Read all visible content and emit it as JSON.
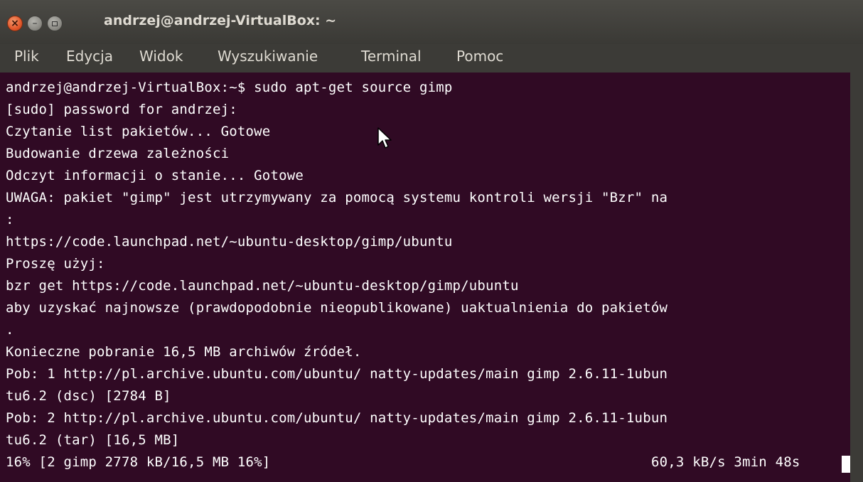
{
  "window": {
    "title": "andrzej@andrzej-VirtualBox: ~",
    "close_glyph": "×",
    "minimize_glyph": "–"
  },
  "menu": [
    "Plik",
    "Edycja",
    "Widok",
    "Wyszukiwanie",
    "Terminal",
    "Pomoc"
  ],
  "terminal": {
    "lines": [
      "andrzej@andrzej-VirtualBox:~$ sudo apt-get source gimp",
      "[sudo] password for andrzej:",
      "Czytanie list pakietów... Gotowe",
      "Budowanie drzewa zależności",
      "Odczyt informacji o stanie... Gotowe",
      "UWAGA: pakiet \"gimp\" jest utrzymywany za pomocą systemu kontroli wersji \"Bzr\" na",
      ":",
      "https://code.launchpad.net/~ubuntu-desktop/gimp/ubuntu",
      "Proszę użyj:",
      "bzr get https://code.launchpad.net/~ubuntu-desktop/gimp/ubuntu",
      "aby uzyskać najnowsze (prawdopodobnie nieopublikowane) uaktualnienia do pakietów",
      ".",
      "Konieczne pobranie 16,5 MB archiwów źródeł.",
      "Pob: 1 http://pl.archive.ubuntu.com/ubuntu/ natty-updates/main gimp 2.6.11-1ubun",
      "tu6.2 (dsc) [2784 B]",
      "Pob: 2 http://pl.archive.ubuntu.com/ubuntu/ natty-updates/main gimp 2.6.11-1ubun",
      "tu6.2 (tar) [16,5 MB]",
      "16% [2 gimp 2778 kB/16,5 MB 16%]"
    ],
    "download_rate": "60,3 kB/s 3min 48s"
  },
  "colors": {
    "terminal_bg": "#300a24",
    "chrome_bg": "#3c3b37",
    "close_button": "#e2572a"
  },
  "icons": {
    "close": "close-icon",
    "minimize": "minimize-icon",
    "maximize": "maximize-icon",
    "pointer": "mouse-pointer-icon"
  }
}
